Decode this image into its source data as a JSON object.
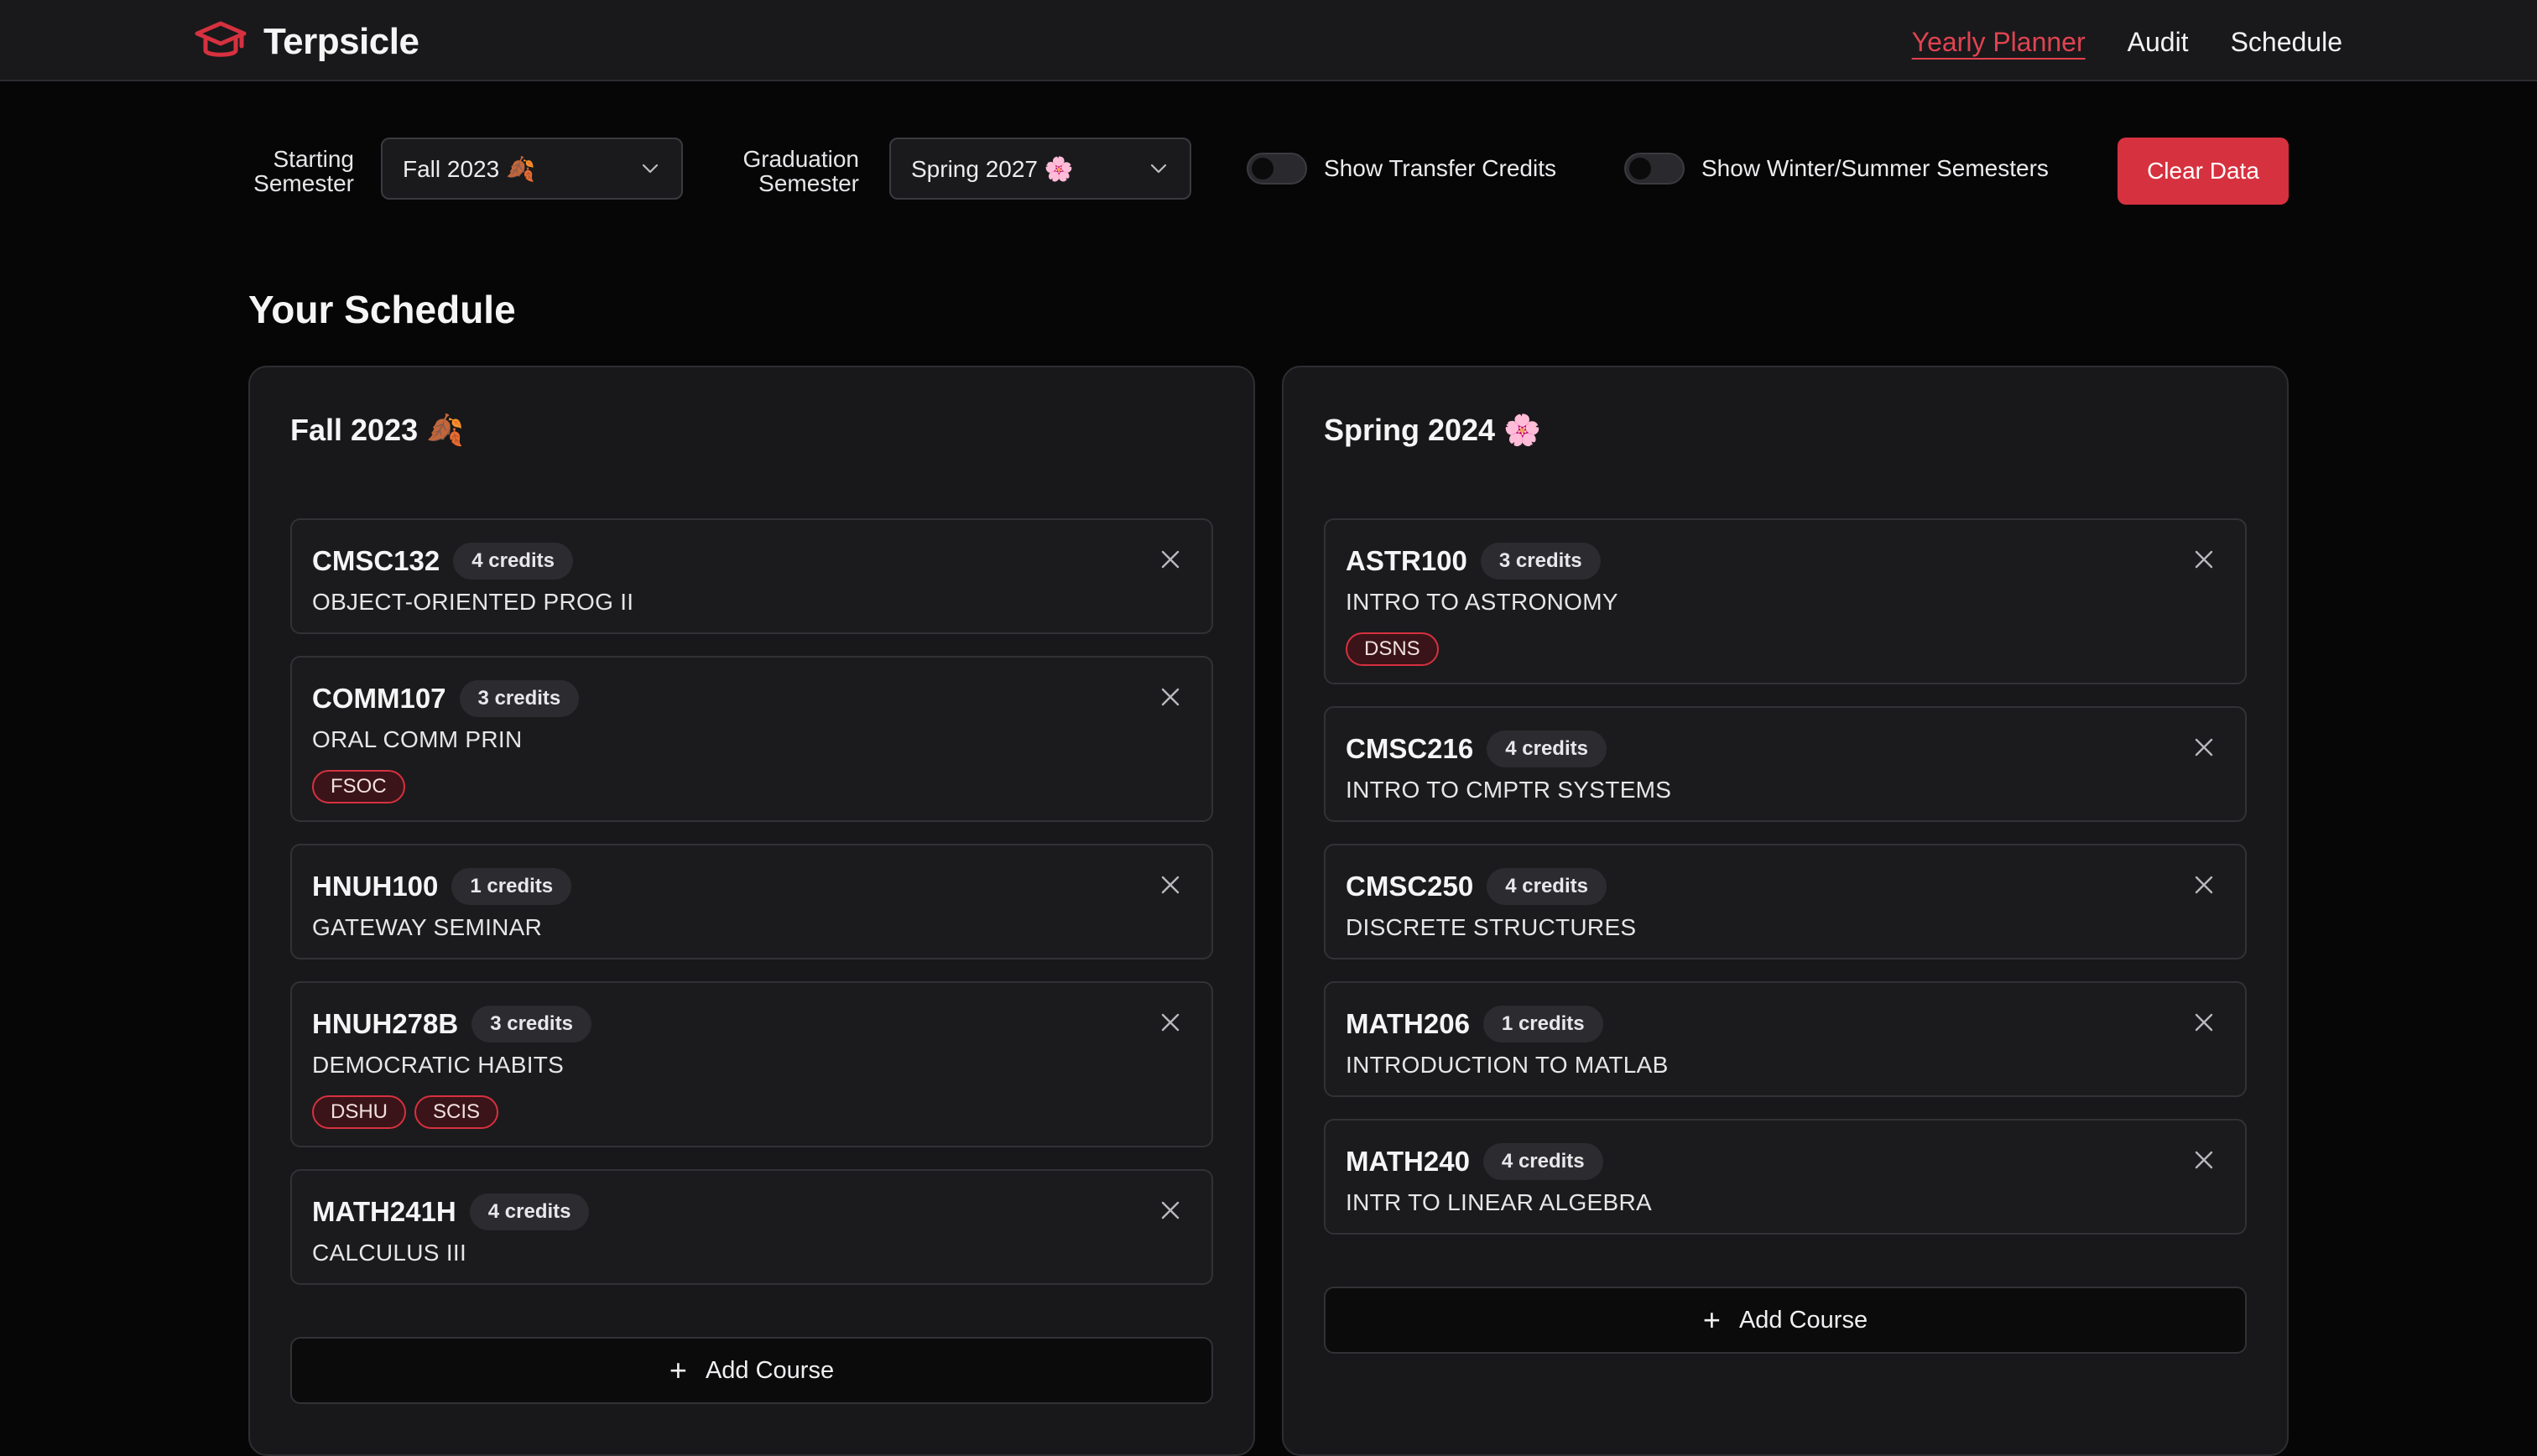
{
  "app": {
    "name": "Terpsicle",
    "logo_icon": "graduation-cap-icon",
    "accent": "#d6313f"
  },
  "nav": [
    {
      "label": "Yearly Planner",
      "active": true
    },
    {
      "label": "Audit",
      "active": false
    },
    {
      "label": "Schedule",
      "active": false
    }
  ],
  "controls": {
    "starting_label_line1": "Starting",
    "starting_label_line2": "Semester",
    "starting_value": "Fall 2023 🍂",
    "graduation_label_line1": "Graduation",
    "graduation_label_line2": "Semester",
    "graduation_value": "Spring 2027 🌸",
    "toggle_transfer": "Show Transfer Credits",
    "toggle_winter_summer": "Show Winter/Summer Semesters",
    "clear_button": "Clear Data"
  },
  "schedule": {
    "title": "Your Schedule",
    "add_course_label": "Add Course",
    "semesters": [
      {
        "title": "Fall 2023 🍂",
        "courses": [
          {
            "code": "CMSC132",
            "credits": "4 credits",
            "name": "OBJECT-ORIENTED PROG II",
            "tags": []
          },
          {
            "code": "COMM107",
            "credits": "3 credits",
            "name": "ORAL COMM PRIN",
            "tags": [
              "FSOC"
            ]
          },
          {
            "code": "HNUH100",
            "credits": "1 credits",
            "name": "GATEWAY SEMINAR",
            "tags": []
          },
          {
            "code": "HNUH278B",
            "credits": "3 credits",
            "name": "DEMOCRATIC HABITS",
            "tags": [
              "DSHU",
              "SCIS"
            ]
          },
          {
            "code": "MATH241H",
            "credits": "4 credits",
            "name": "CALCULUS III",
            "tags": []
          }
        ]
      },
      {
        "title": "Spring 2024 🌸",
        "courses": [
          {
            "code": "ASTR100",
            "credits": "3 credits",
            "name": "INTRO TO ASTRONOMY",
            "tags": [
              "DSNS"
            ]
          },
          {
            "code": "CMSC216",
            "credits": "4 credits",
            "name": "INTRO TO CMPTR SYSTEMS",
            "tags": []
          },
          {
            "code": "CMSC250",
            "credits": "4 credits",
            "name": "DISCRETE STRUCTURES",
            "tags": []
          },
          {
            "code": "MATH206",
            "credits": "1 credits",
            "name": "INTRODUCTION TO MATLAB",
            "tags": []
          },
          {
            "code": "MATH240",
            "credits": "4 credits",
            "name": "INTR TO LINEAR ALGEBRA",
            "tags": []
          }
        ]
      }
    ]
  }
}
